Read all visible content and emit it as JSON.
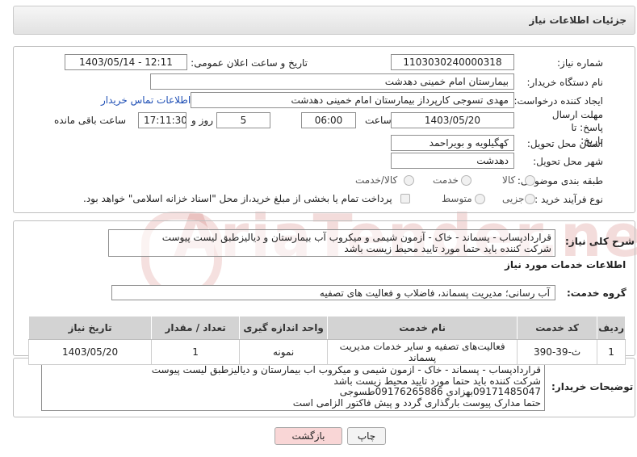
{
  "header": {
    "title": "جزئیات اطلاعات نیاز"
  },
  "fields": {
    "need_number_label": "شماره نیاز:",
    "need_number": "1103030240000318",
    "announce_label": "تاریخ و ساعت اعلان عمومی:",
    "announce_value": "1403/05/14 - 12:11",
    "buyer_org_label": "نام دستگاه خریدار:",
    "buyer_org": "بیمارستان امام خمینی دهدشت",
    "requester_label": "ایجاد کننده درخواست:",
    "requester": "مهدی تسوجی کارپرداز بیمارستان امام خمینی دهدشت",
    "contact_link": "اطلاعات تماس خریدار",
    "deadline_label": "مهلت ارسال پاسخ: تا تاریخ:",
    "deadline_date": "1403/05/20",
    "time_label": "ساعت",
    "deadline_time": "06:00",
    "days_value": "5",
    "days_label": "روز و",
    "remaining_time": "17:11:30",
    "remaining_label": "ساعت باقی مانده",
    "province_label": "استان محل تحویل:",
    "province": "کهگیلویه و بویراحمد",
    "city_label": "شهر محل تحویل:",
    "city": "دهدشت",
    "category_label": "طبقه بندی موضوعی:",
    "category_options": [
      "کالا",
      "خدمت",
      "کالا/خدمت"
    ],
    "process_label": "نوع فرآیند خرید :",
    "process_options": [
      "جزیی",
      "متوسط"
    ],
    "payment_note": "پرداخت تمام یا بخشی از مبلغ خرید،از محل \"اسناد خزانه اسلامی\" خواهد بود."
  },
  "description": {
    "label": "شرح کلی نیاز:",
    "lines": [
      "قراردادپساب - پسماند - خاک - آزمون شیمی و میکروب آب بیمارستان و دیالیزطبق لیست پیوست",
      "شرکت کننده باید حتما مورد تایید محیط زیست باشد"
    ]
  },
  "services": {
    "section_title": "اطلاعات خدمات مورد نیاز",
    "group_label": "گروه خدمت:",
    "group_value": "آب رسانی؛ مدیریت پسماند، فاضلاب و فعالیت های تصفیه",
    "columns": [
      "ردیف",
      "کد خدمت",
      "نام خدمت",
      "واحد اندازه گیری",
      "تعداد / مقدار",
      "تاریخ نیاز"
    ],
    "rows": [
      [
        "1",
        "ث-39-390",
        "فعالیت‌های تصفیه و سایر خدمات مدیریت پسماند",
        "نمونه",
        "1",
        "1403/05/20"
      ]
    ]
  },
  "buyer_notes": {
    "label": "توضیحات خریدار:",
    "lines": [
      "قراردادپساب - پسماند - خاک - آزمون شیمی و میکروب آب بیمارستان و دیالیزطبق لیست پیوست",
      "شرکت کننده باید حتما مورد تایید محیط زیست باشد",
      "09171485047بهزادی 09176265886طسوجی",
      "حتما مدارک پیوست بارگذاری گردد و پیش فاکتور الزامی است"
    ]
  },
  "buttons": {
    "print": "چاپ",
    "back": "بازگشت"
  },
  "watermark": "AriaTender.neT",
  "colors": {
    "link": "#1f4fb5",
    "back_button_bg": "#f9d6d6",
    "print_button_bg": "#f3f3f3",
    "header_bg": "#e6e6e6"
  }
}
